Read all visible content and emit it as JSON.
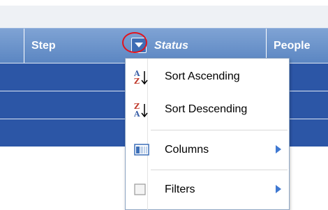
{
  "grid": {
    "columns": [
      {
        "label": "",
        "italic": false
      },
      {
        "label": "Step",
        "italic": false
      },
      {
        "label": "Status",
        "italic": true
      },
      {
        "label": "People",
        "italic": false
      }
    ],
    "row_count": 3
  },
  "menu": {
    "items": [
      {
        "label": "Sort Ascending",
        "icon": "sort-ascending-icon"
      },
      {
        "label": "Sort Descending",
        "icon": "sort-descending-icon"
      },
      {
        "label": "Columns",
        "icon": "columns-icon",
        "submenu": true
      },
      {
        "label": "Filters",
        "icon": "checkbox-icon",
        "submenu": true
      }
    ]
  },
  "colors": {
    "header": "#5b86c2",
    "row": "#2c56a6",
    "highlight_circle": "#e0141e",
    "submenu_arrow": "#3f78d1"
  }
}
